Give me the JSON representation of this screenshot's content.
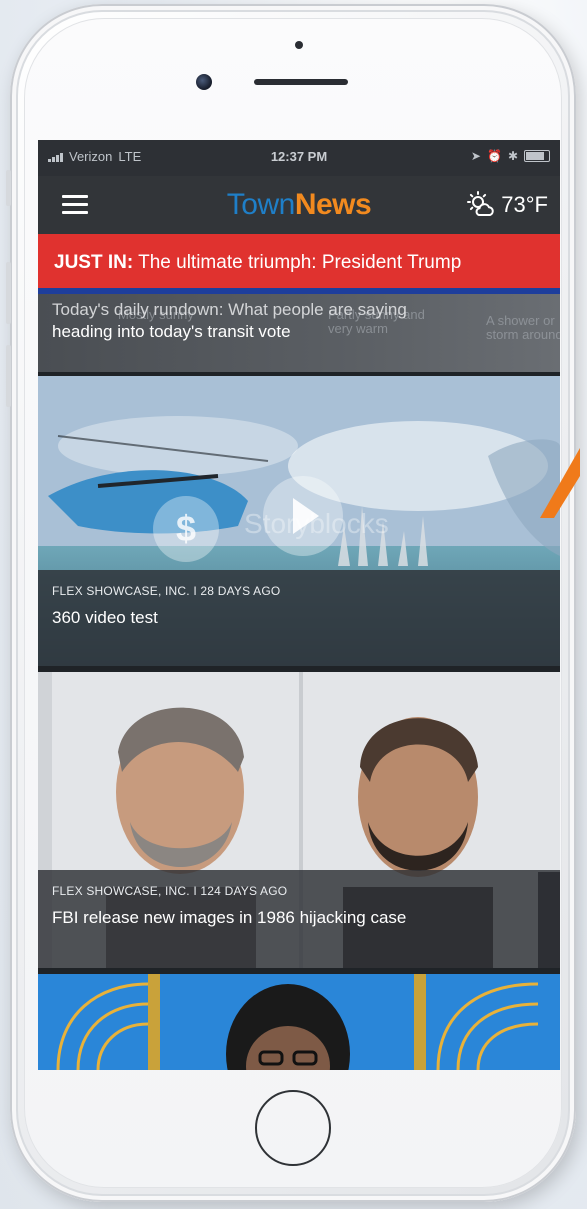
{
  "status_bar": {
    "carrier": "Verizon",
    "network": "LTE",
    "time": "12:37 PM"
  },
  "header": {
    "logo_part1": "Town",
    "logo_part2": "News",
    "weather_temp": "73°F",
    "weather_icon": "partly-cloudy-sun-icon"
  },
  "breaking": {
    "label": "JUST IN:",
    "text": "The ultimate triumph: President Trump"
  },
  "partial_story": {
    "headline_top": "Today's daily rundown: What people are saying",
    "headline": "heading into today's transit vote",
    "ghost_labels": [
      "Mostly sunny",
      "Partly sunny and very warm",
      "A shower or storm around"
    ]
  },
  "stories": [
    {
      "meta": "FLEX SHOWCASE, INC. I 28 DAYS AGO",
      "title": "360 video test",
      "watermark": "Storyblocks"
    },
    {
      "meta": "FLEX SHOWCASE, INC. I 124 DAYS AGO",
      "title": "FBI release new images in 1986 hijacking case"
    }
  ],
  "colors": {
    "breaking_bg": "#e0322f",
    "breaking_stripe": "#1e3e9c",
    "logo_town": "#1f7fc8",
    "logo_news": "#f28a1f",
    "header_bg": "#323539",
    "pointer": "#f07a1a"
  }
}
